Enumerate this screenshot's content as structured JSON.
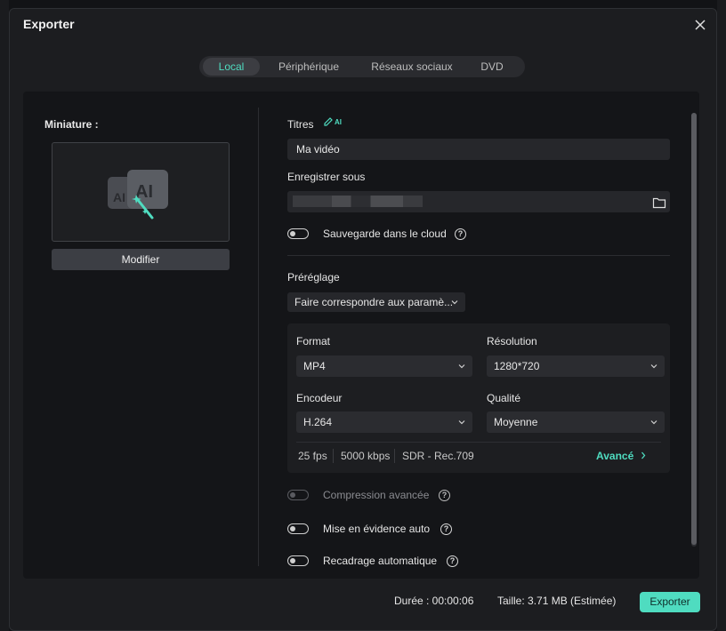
{
  "dialog": {
    "title": "Exporter"
  },
  "tabs": [
    {
      "label": "Local",
      "active": true
    },
    {
      "label": "Périphérique",
      "active": false
    },
    {
      "label": "Réseaux sociaux",
      "active": false
    },
    {
      "label": "DVD",
      "active": false
    }
  ],
  "thumbnail": {
    "label": "Miniature :",
    "modify_label": "Modifier"
  },
  "form": {
    "title_label": "Titres",
    "ai_badge": "AI",
    "title_value": "Ma vidéo",
    "save_as_label": "Enregistrer sous",
    "save_path_value": "",
    "cloud_toggle_label": "Sauvegarde dans le cloud",
    "preset_label": "Préréglage",
    "preset_value": "Faire correspondre aux paramè...",
    "format_label": "Format",
    "format_value": "MP4",
    "resolution_label": "Résolution",
    "resolution_value": "1280*720",
    "encoder_label": "Encodeur",
    "encoder_value": "H.264",
    "quality_label": "Qualité",
    "quality_value": "Moyenne",
    "fps": "25 fps",
    "bitrate": "5000 kbps",
    "color_space": "SDR - Rec.709",
    "advanced_label": "Avancé",
    "advanced_compression_label": "Compression avancée",
    "auto_highlight_label": "Mise en évidence auto",
    "auto_reframe_label": "Recadrage automatique"
  },
  "footer": {
    "duration": "Durée : 00:00:06",
    "size": "Taille: 3.71 MB (Estimée)",
    "export_label": "Exporter"
  },
  "colors": {
    "accent": "#4fdcc0",
    "panel": "#141518",
    "dialog": "#1c1d20"
  }
}
